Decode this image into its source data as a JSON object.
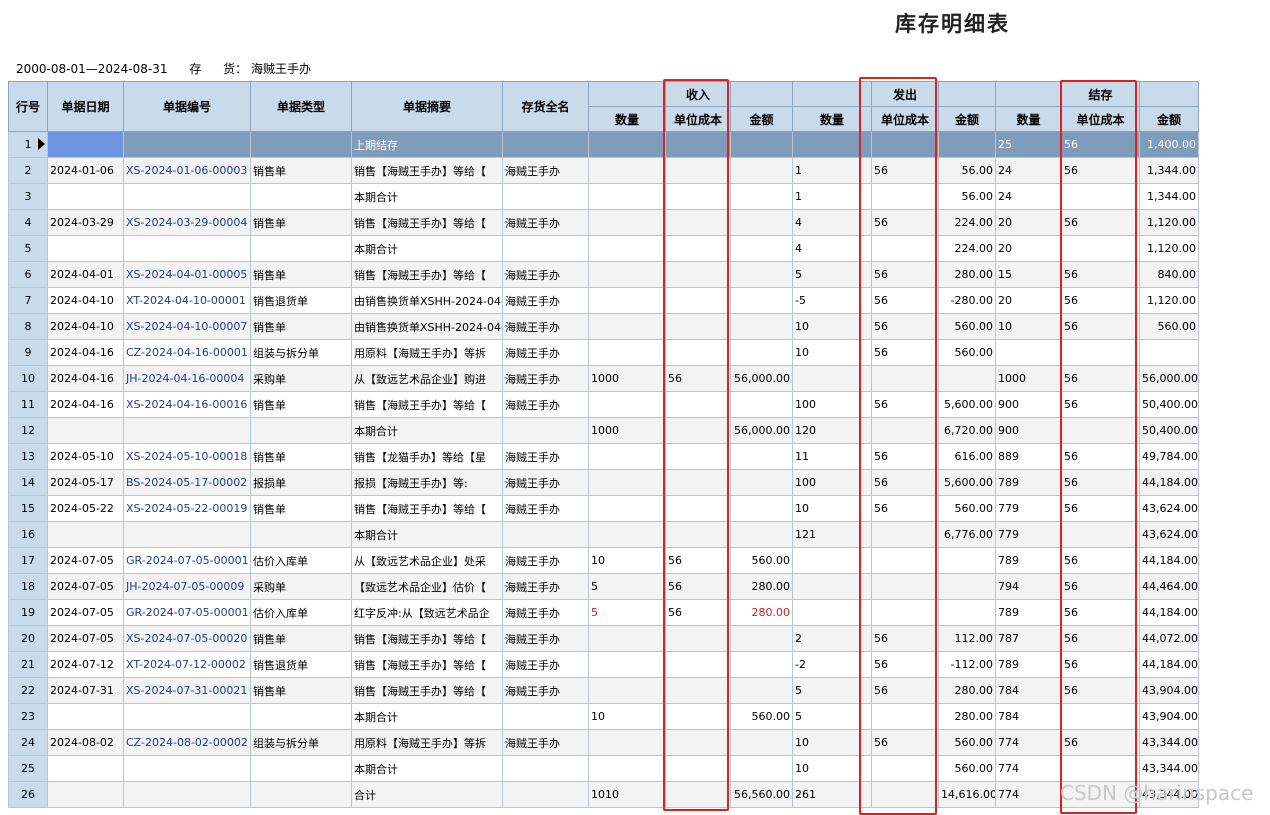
{
  "title": "库存明细表",
  "info": {
    "date_range": "2000-08-01—2024-08-31",
    "label_1": "存",
    "label_2": "货：",
    "item": "海贼王手办"
  },
  "columns": {
    "rowno": "行号",
    "date": "单据日期",
    "code": "单据编号",
    "type": "单据类型",
    "summary": "单据摘要",
    "item": "存货全名",
    "in_group": "收入",
    "out_group": "发出",
    "stock_group": "结存",
    "qty": "数量",
    "unit_cost": "单位成本",
    "amount": "金额"
  },
  "rows": [
    {
      "no": "1",
      "date": "",
      "code": "",
      "type": "",
      "summary": "上期结存",
      "item": "",
      "in_qty": "",
      "in_cost": "",
      "in_amt": "",
      "out_qty": "",
      "out_cost": "",
      "out_amt": "",
      "s_qty": "25",
      "s_cost": "56",
      "s_amt": "1,400.00"
    },
    {
      "no": "2",
      "date": "2024-01-06",
      "code": "XS-2024-01-06-00003",
      "type": "销售单",
      "summary": "销售【海贼王手办】等给【",
      "item": "海贼王手办",
      "in_qty": "",
      "in_cost": "",
      "in_amt": "",
      "out_qty": "1",
      "out_cost": "56",
      "out_amt": "56.00",
      "s_qty": "24",
      "s_cost": "56",
      "s_amt": "1,344.00"
    },
    {
      "no": "3",
      "date": "",
      "code": "",
      "type": "",
      "summary": "本期合计",
      "item": "",
      "in_qty": "",
      "in_cost": "",
      "in_amt": "",
      "out_qty": "1",
      "out_cost": "",
      "out_amt": "56.00",
      "s_qty": "24",
      "s_cost": "",
      "s_amt": "1,344.00"
    },
    {
      "no": "4",
      "date": "2024-03-29",
      "code": "XS-2024-03-29-00004",
      "type": "销售单",
      "summary": "销售【海贼王手办】等给【",
      "item": "海贼王手办",
      "in_qty": "",
      "in_cost": "",
      "in_amt": "",
      "out_qty": "4",
      "out_cost": "56",
      "out_amt": "224.00",
      "s_qty": "20",
      "s_cost": "56",
      "s_amt": "1,120.00"
    },
    {
      "no": "5",
      "date": "",
      "code": "",
      "type": "",
      "summary": "本期合计",
      "item": "",
      "in_qty": "",
      "in_cost": "",
      "in_amt": "",
      "out_qty": "4",
      "out_cost": "",
      "out_amt": "224.00",
      "s_qty": "20",
      "s_cost": "",
      "s_amt": "1,120.00"
    },
    {
      "no": "6",
      "date": "2024-04-01",
      "code": "XS-2024-04-01-00005",
      "type": "销售单",
      "summary": "销售【海贼王手办】等给【",
      "item": "海贼王手办",
      "in_qty": "",
      "in_cost": "",
      "in_amt": "",
      "out_qty": "5",
      "out_cost": "56",
      "out_amt": "280.00",
      "s_qty": "15",
      "s_cost": "56",
      "s_amt": "840.00"
    },
    {
      "no": "7",
      "date": "2024-04-10",
      "code": "XT-2024-04-10-00001",
      "type": "销售退货单",
      "summary": "由销售换货单XSHH-2024-04-",
      "item": "海贼王手办",
      "in_qty": "",
      "in_cost": "",
      "in_amt": "",
      "out_qty": "-5",
      "out_cost": "56",
      "out_amt": "-280.00",
      "s_qty": "20",
      "s_cost": "56",
      "s_amt": "1,120.00"
    },
    {
      "no": "8",
      "date": "2024-04-10",
      "code": "XS-2024-04-10-00007",
      "type": "销售单",
      "summary": "由销售换货单XSHH-2024-04-",
      "item": "海贼王手办",
      "in_qty": "",
      "in_cost": "",
      "in_amt": "",
      "out_qty": "10",
      "out_cost": "56",
      "out_amt": "560.00",
      "s_qty": "10",
      "s_cost": "56",
      "s_amt": "560.00"
    },
    {
      "no": "9",
      "date": "2024-04-16",
      "code": "CZ-2024-04-16-00001",
      "type": "组装与拆分单",
      "summary": "用原料【海贼王手办】等拆",
      "item": "海贼王手办",
      "in_qty": "",
      "in_cost": "",
      "in_amt": "",
      "out_qty": "10",
      "out_cost": "56",
      "out_amt": "560.00",
      "s_qty": "",
      "s_cost": "",
      "s_amt": ""
    },
    {
      "no": "10",
      "date": "2024-04-16",
      "code": "JH-2024-04-16-00004",
      "type": "采购单",
      "summary": "从【致远艺术品企业】购进",
      "item": "海贼王手办",
      "in_qty": "1000",
      "in_cost": "56",
      "in_amt": "56,000.00",
      "out_qty": "",
      "out_cost": "",
      "out_amt": "",
      "s_qty": "1000",
      "s_cost": "56",
      "s_amt": "56,000.00"
    },
    {
      "no": "11",
      "date": "2024-04-16",
      "code": "XS-2024-04-16-00016",
      "type": "销售单",
      "summary": "销售【海贼王手办】等给【",
      "item": "海贼王手办",
      "in_qty": "",
      "in_cost": "",
      "in_amt": "",
      "out_qty": "100",
      "out_cost": "56",
      "out_amt": "5,600.00",
      "s_qty": "900",
      "s_cost": "56",
      "s_amt": "50,400.00"
    },
    {
      "no": "12",
      "date": "",
      "code": "",
      "type": "",
      "summary": "本期合计",
      "item": "",
      "in_qty": "1000",
      "in_cost": "",
      "in_amt": "56,000.00",
      "out_qty": "120",
      "out_cost": "",
      "out_amt": "6,720.00",
      "s_qty": "900",
      "s_cost": "",
      "s_amt": "50,400.00"
    },
    {
      "no": "13",
      "date": "2024-05-10",
      "code": "XS-2024-05-10-00018",
      "type": "销售单",
      "summary": "销售【龙猫手办】等给【星",
      "item": "海贼王手办",
      "in_qty": "",
      "in_cost": "",
      "in_amt": "",
      "out_qty": "11",
      "out_cost": "56",
      "out_amt": "616.00",
      "s_qty": "889",
      "s_cost": "56",
      "s_amt": "49,784.00"
    },
    {
      "no": "14",
      "date": "2024-05-17",
      "code": "BS-2024-05-17-00002",
      "type": "报损单",
      "summary": "报损【海贼王手办】等:",
      "item": "海贼王手办",
      "in_qty": "",
      "in_cost": "",
      "in_amt": "",
      "out_qty": "100",
      "out_cost": "56",
      "out_amt": "5,600.00",
      "s_qty": "789",
      "s_cost": "56",
      "s_amt": "44,184.00"
    },
    {
      "no": "15",
      "date": "2024-05-22",
      "code": "XS-2024-05-22-00019",
      "type": "销售单",
      "summary": "销售【海贼王手办】等给【",
      "item": "海贼王手办",
      "in_qty": "",
      "in_cost": "",
      "in_amt": "",
      "out_qty": "10",
      "out_cost": "56",
      "out_amt": "560.00",
      "s_qty": "779",
      "s_cost": "56",
      "s_amt": "43,624.00"
    },
    {
      "no": "16",
      "date": "",
      "code": "",
      "type": "",
      "summary": "本期合计",
      "item": "",
      "in_qty": "",
      "in_cost": "",
      "in_amt": "",
      "out_qty": "121",
      "out_cost": "",
      "out_amt": "6,776.00",
      "s_qty": "779",
      "s_cost": "",
      "s_amt": "43,624.00"
    },
    {
      "no": "17",
      "date": "2024-07-05",
      "code": "GR-2024-07-05-00001",
      "type": "估价入库单",
      "summary": "从【致远艺术品企业】处采",
      "item": "海贼王手办",
      "in_qty": "10",
      "in_cost": "56",
      "in_amt": "560.00",
      "out_qty": "",
      "out_cost": "",
      "out_amt": "",
      "s_qty": "789",
      "s_cost": "56",
      "s_amt": "44,184.00"
    },
    {
      "no": "18",
      "date": "2024-07-05",
      "code": "JH-2024-07-05-00009",
      "type": "采购单",
      "summary": "【致远艺术品企业】估价【",
      "item": "海贼王手办",
      "in_qty": "5",
      "in_cost": "56",
      "in_amt": "280.00",
      "out_qty": "",
      "out_cost": "",
      "out_amt": "",
      "s_qty": "794",
      "s_cost": "56",
      "s_amt": "44,464.00"
    },
    {
      "no": "19",
      "date": "2024-07-05",
      "code": "GR-2024-07-05-00001",
      "type": "估价入库单",
      "summary": "红字反冲:从【致远艺术品企",
      "item": "海贼王手办",
      "in_qty": "5",
      "in_cost": "56",
      "in_amt": "280.00",
      "out_qty": "",
      "out_cost": "",
      "out_amt": "",
      "s_qty": "789",
      "s_cost": "56",
      "s_amt": "44,184.00",
      "red": true
    },
    {
      "no": "20",
      "date": "2024-07-05",
      "code": "XS-2024-07-05-00020",
      "type": "销售单",
      "summary": "销售【海贼王手办】等给【",
      "item": "海贼王手办",
      "in_qty": "",
      "in_cost": "",
      "in_amt": "",
      "out_qty": "2",
      "out_cost": "56",
      "out_amt": "112.00",
      "s_qty": "787",
      "s_cost": "56",
      "s_amt": "44,072.00"
    },
    {
      "no": "21",
      "date": "2024-07-12",
      "code": "XT-2024-07-12-00002",
      "type": "销售退货单",
      "summary": "销售【海贼王手办】等给【",
      "item": "海贼王手办",
      "in_qty": "",
      "in_cost": "",
      "in_amt": "",
      "out_qty": "-2",
      "out_cost": "56",
      "out_amt": "-112.00",
      "s_qty": "789",
      "s_cost": "56",
      "s_amt": "44,184.00"
    },
    {
      "no": "22",
      "date": "2024-07-31",
      "code": "XS-2024-07-31-00021",
      "type": "销售单",
      "summary": "销售【海贼王手办】等给【",
      "item": "海贼王手办",
      "in_qty": "",
      "in_cost": "",
      "in_amt": "",
      "out_qty": "5",
      "out_cost": "56",
      "out_amt": "280.00",
      "s_qty": "784",
      "s_cost": "56",
      "s_amt": "43,904.00"
    },
    {
      "no": "23",
      "date": "",
      "code": "",
      "type": "",
      "summary": "本期合计",
      "item": "",
      "in_qty": "10",
      "in_cost": "",
      "in_amt": "560.00",
      "out_qty": "5",
      "out_cost": "",
      "out_amt": "280.00",
      "s_qty": "784",
      "s_cost": "",
      "s_amt": "43,904.00"
    },
    {
      "no": "24",
      "date": "2024-08-02",
      "code": "CZ-2024-08-02-00002",
      "type": "组装与拆分单",
      "summary": "用原料【海贼王手办】等拆",
      "item": "海贼王手办",
      "in_qty": "",
      "in_cost": "",
      "in_amt": "",
      "out_qty": "10",
      "out_cost": "56",
      "out_amt": "560.00",
      "s_qty": "774",
      "s_cost": "56",
      "s_amt": "43,344.00"
    },
    {
      "no": "25",
      "date": "",
      "code": "",
      "type": "",
      "summary": "本期合计",
      "item": "",
      "in_qty": "",
      "in_cost": "",
      "in_amt": "",
      "out_qty": "10",
      "out_cost": "",
      "out_amt": "560.00",
      "s_qty": "774",
      "s_cost": "",
      "s_amt": "43,344.00"
    },
    {
      "no": "26",
      "date": "",
      "code": "",
      "type": "",
      "summary": "合计",
      "item": "",
      "in_qty": "1010",
      "in_cost": "",
      "in_amt": "56,560.00",
      "out_qty": "261",
      "out_cost": "",
      "out_amt": "14,616.00",
      "s_qty": "774",
      "s_cost": "",
      "s_amt": "43,344.00"
    }
  ],
  "watermark": "CSDN @harinspace",
  "colors": {
    "header_bg": "#c9daea",
    "selected_row": "#7f9cba",
    "highlight_box": "#e02020",
    "code_link": "#1d3a9a",
    "negative": "#d12020"
  }
}
